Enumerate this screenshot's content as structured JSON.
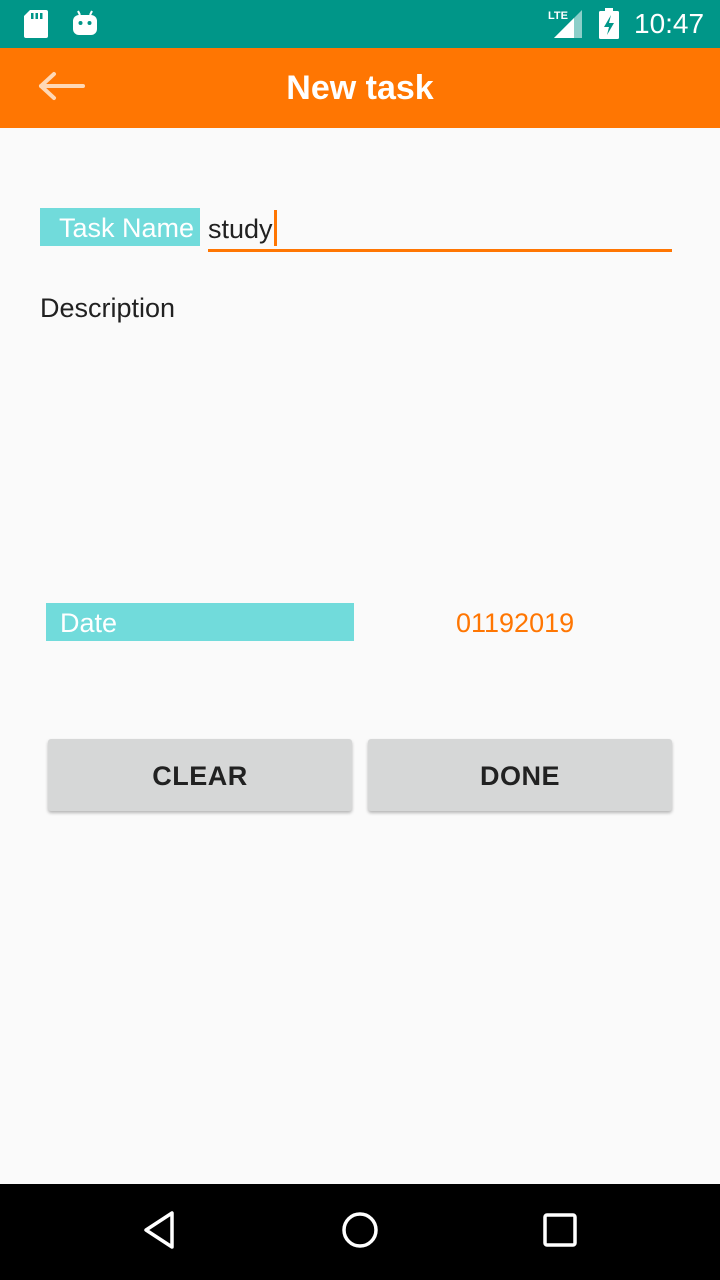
{
  "status_bar": {
    "time": "10:47",
    "network": "LTE",
    "icons": [
      "sd-card-icon",
      "android-icon",
      "lte-signal-icon",
      "battery-charging-icon"
    ]
  },
  "toolbar": {
    "title": "New task",
    "back_icon": "arrow-back-icon",
    "background": "#FF7602"
  },
  "form": {
    "task_name_label": "Task Name",
    "task_name_value": "study",
    "description_label": "Description",
    "date_label": "Date",
    "date_value": "01192019",
    "label_bg": "#71DBDB",
    "accent": "#FF7602"
  },
  "buttons": {
    "clear": "CLEAR",
    "done": "DONE"
  },
  "nav_bar": {
    "icons": [
      "back-triangle-icon",
      "home-circle-icon",
      "recents-square-icon"
    ]
  }
}
